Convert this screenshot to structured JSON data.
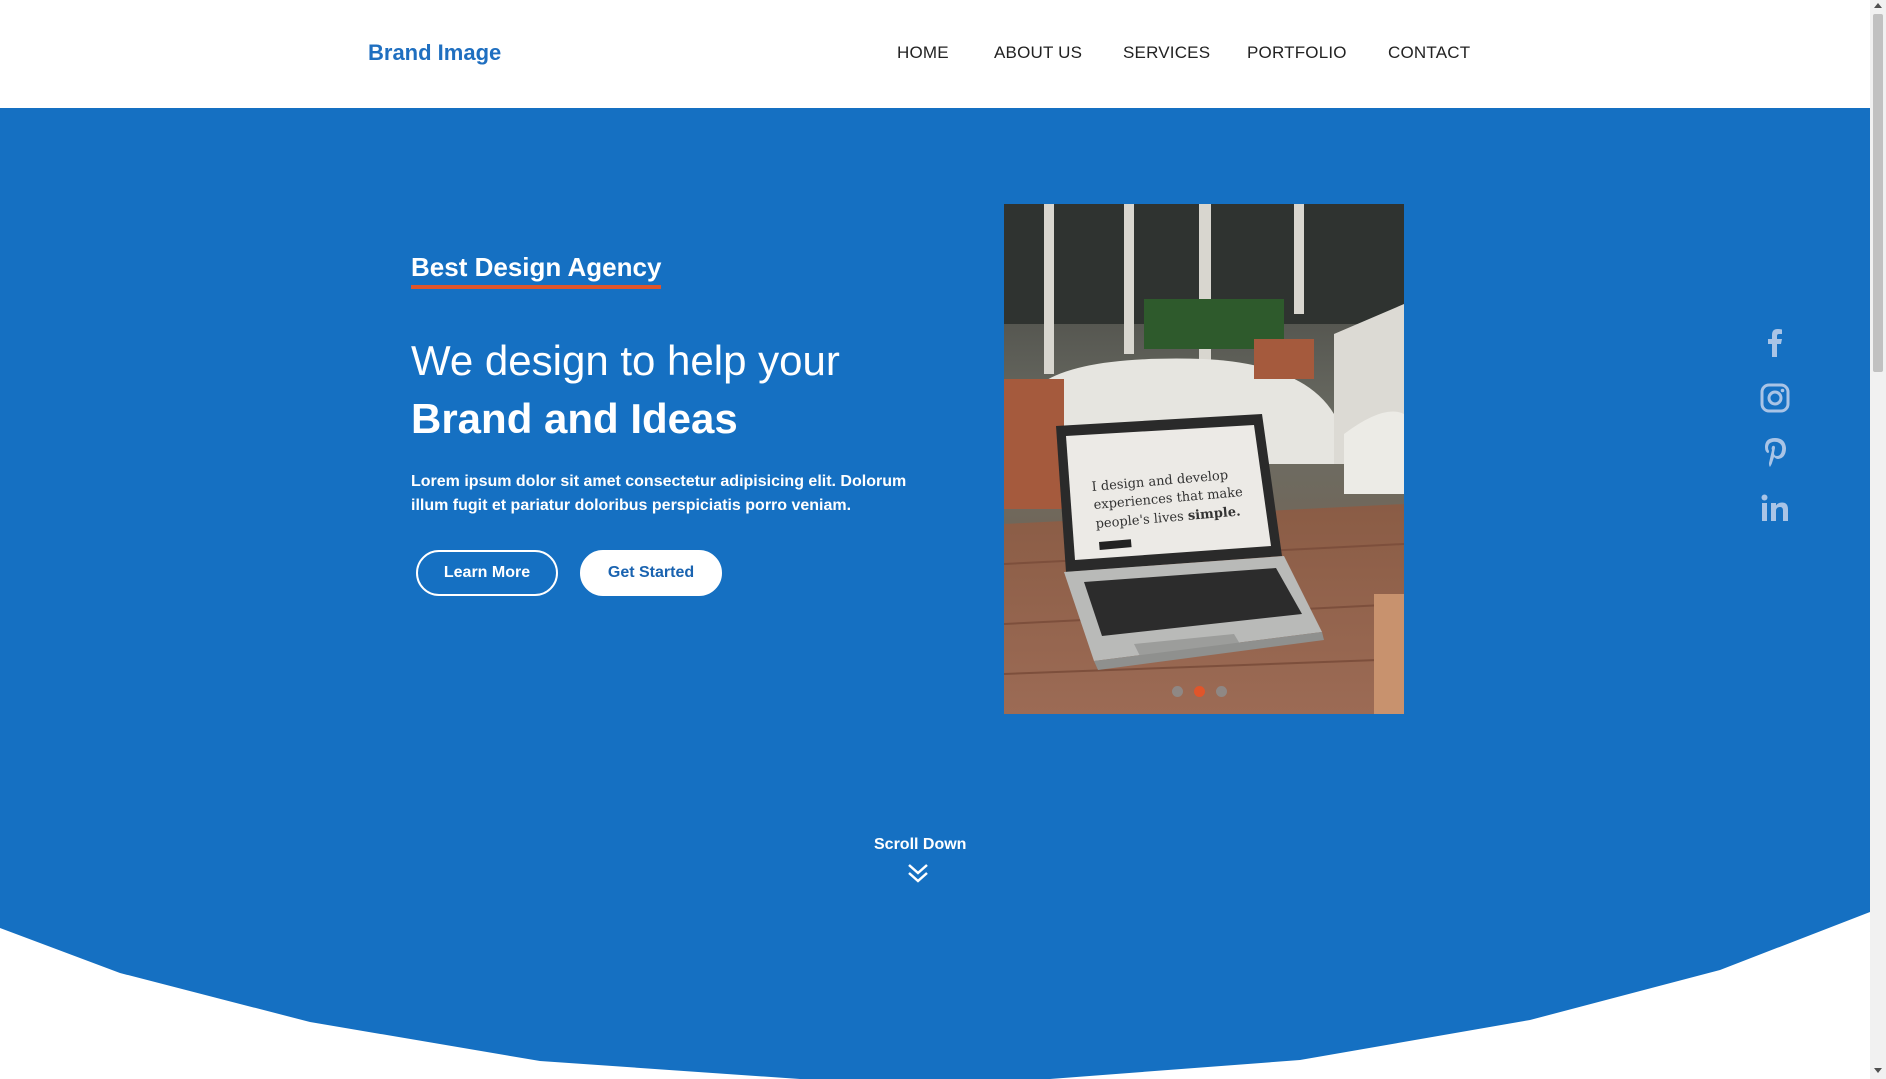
{
  "header": {
    "brand": "Brand Image",
    "nav": [
      "HOME",
      "ABOUT US",
      "SERVICES",
      "PORTFOLIO",
      "CONTACT"
    ]
  },
  "hero": {
    "tagline": "Best Design Agency",
    "headline_line1": "We design to help your",
    "headline_line2": "Brand and Ideas",
    "description": "Lorem ipsum dolor sit amet consectetur adipisicing elit. Dolorum illum fugit et pariatur doloribus perspiciatis porro veniam.",
    "learn_more": "Learn More",
    "get_started": "Get Started",
    "scroll_label": "Scroll Down",
    "photo_screen_text_line1": "I design and develop",
    "photo_screen_text_line2": "experiences that make",
    "photo_screen_text_line3": "people's lives ",
    "photo_screen_text_bold": "simple.",
    "carousel_active_index": 2,
    "carousel_count": 3
  },
  "social": [
    "facebook-icon",
    "instagram-icon",
    "pinterest-icon",
    "linkedin-icon"
  ],
  "colors": {
    "brand_blue": "#1570c2",
    "accent_orange": "#e0552a",
    "nav_text": "#222222",
    "social_icon": "#a9c4e6"
  }
}
